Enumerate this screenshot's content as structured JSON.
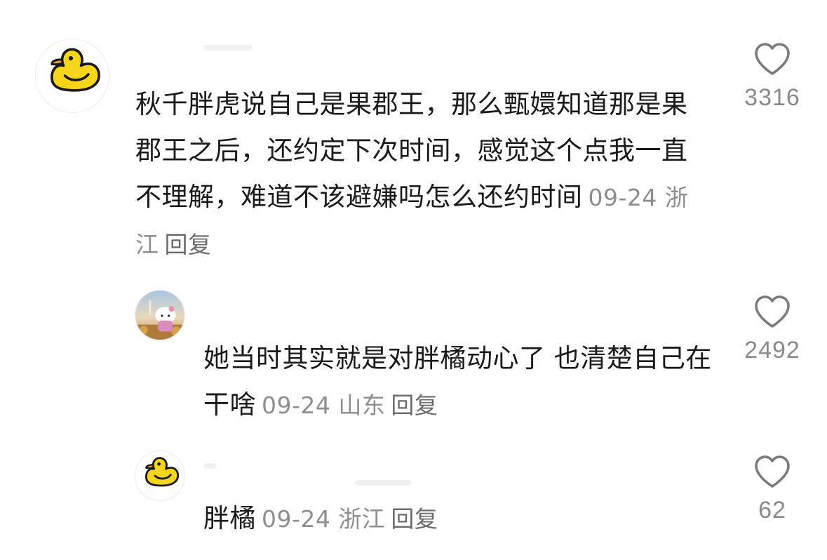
{
  "comments": [
    {
      "text": "秋千胖虎说自己是果郡王，那么甄嬛知道那是果郡王之后，还约定下次时间，感觉这个点我一直不理解，难道不该避嫌吗怎么还约时间",
      "date": "09-24",
      "location": "浙江",
      "reply": "回复",
      "likes": "3316",
      "avatar": "duck-icon"
    },
    {
      "text": "她当时其实就是对胖橘动心了 也清楚自己在干啥",
      "date": "09-24",
      "location": "山东",
      "reply": "回复",
      "likes": "2492",
      "avatar": "hello-kitty-photo"
    },
    {
      "text": "胖橘",
      "date": "09-24",
      "location": "浙江",
      "reply": "回复",
      "likes": "62",
      "avatar": "duck-icon"
    }
  ],
  "colors": {
    "text": "#1a1a1a",
    "meta": "#8e8e8e",
    "duck": "#f7d51b"
  }
}
